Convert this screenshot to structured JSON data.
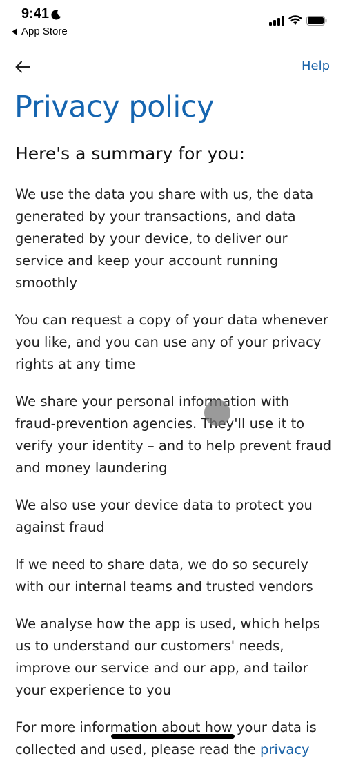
{
  "status_bar": {
    "time": "9:41",
    "back_to_app": "App Store"
  },
  "nav": {
    "help_label": "Help"
  },
  "page": {
    "title": "Privacy policy",
    "subtitle": "Here's a summary for you:",
    "paragraphs": [
      "We use the data you share with us, the data generated by your transactions, and data generated by your device, to deliver our service and keep your account running smoothly",
      "You can request a copy of your data whenever you like, and you can use any of your privacy rights at any time",
      "We share your personal information with fraud-prevention agencies. They'll use it to verify your identity – and to help prevent fraud and money laundering",
      "We also use your device data to protect you against fraud",
      "If we need to share data, we do so securely with our internal teams and trusted vendors",
      "We analyse how the app is used, which helps us to understand our customers' needs, improve our service and our app, and tailor your experience to you"
    ],
    "last_paragraph_text": "For more information about how your data is collected and used, please read the ",
    "last_paragraph_link": "privacy"
  },
  "colors": {
    "accent": "#1565b0",
    "link": "#1a63a8"
  }
}
